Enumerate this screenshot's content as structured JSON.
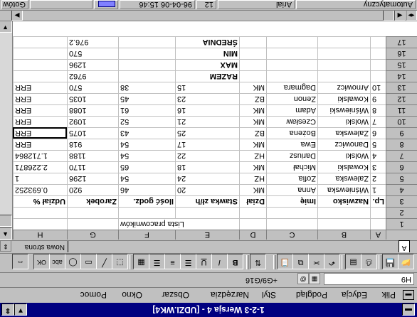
{
  "window": {
    "title": "1-2-3 Wersja 4 - [UDZI.WK4]"
  },
  "menu": {
    "items": [
      "Plik",
      "Edycja",
      "Podgląd",
      "Styl",
      "Narzędzia",
      "Obszar",
      "Okno",
      "Pomoc"
    ]
  },
  "formula_bar": {
    "cell_ref": "H9",
    "formula": "+G9/G16"
  },
  "toolbar": {
    "buttons": [
      "open-file",
      "save-file",
      "print",
      "preview",
      "undo",
      "cut",
      "copy",
      "paste",
      "sort",
      "bold",
      "italic",
      "underline",
      "align-left",
      "align-center",
      "align-right",
      "number-format",
      "select",
      "draw-line",
      "rectangle",
      "ellipse",
      "abc",
      "ok"
    ],
    "bold_label": "B",
    "italic_label": "I",
    "underline_label": "U",
    "abc_label": "abc",
    "ok_label": "OK"
  },
  "sheet": {
    "tab_label": "A",
    "new_sheet_label": "Nowa strona"
  },
  "columns": [
    "A",
    "B",
    "C",
    "D",
    "E",
    "F",
    "G",
    "H"
  ],
  "rows": [
    {
      "n": "1",
      "cells": [
        "",
        "",
        "",
        "",
        "Lista pracowników",
        "",
        "",
        ""
      ]
    },
    {
      "n": "2",
      "cells": [
        "",
        "",
        "",
        "",
        "",
        "",
        "",
        ""
      ]
    },
    {
      "n": "3",
      "cells": [
        "Lp.",
        "Nazwisko",
        "Imię",
        "Dział",
        "Stawka zł/h",
        "Ilość godz.",
        "Zarobek",
        "Udział %"
      ]
    },
    {
      "n": "4",
      "cells": [
        "1",
        "Wiśniewska",
        "Anna",
        "MK",
        "20",
        "46",
        "920",
        "0.693252"
      ]
    },
    {
      "n": "5",
      "cells": [
        "2",
        "Zalewska",
        "Zofia",
        "HZ",
        "24",
        "54",
        "1296",
        "1"
      ]
    },
    {
      "n": "6",
      "cells": [
        "3",
        "Kowalski",
        "Michał",
        "MK",
        "18",
        "65",
        "1170",
        "2.226871"
      ]
    },
    {
      "n": "7",
      "cells": [
        "4",
        "Wolski",
        "Dariusz",
        "HZ",
        "22",
        "54",
        "1188",
        "1.712864"
      ]
    },
    {
      "n": "8",
      "cells": [
        "5",
        "Danowicz",
        "Ewa",
        "MK",
        "17",
        "54",
        "918",
        "ERR"
      ]
    },
    {
      "n": "9",
      "cells": [
        "6",
        "Zalewska",
        "Bożena",
        "BZ",
        "25",
        "43",
        "1075",
        "ERR"
      ]
    },
    {
      "n": "10",
      "cells": [
        "7",
        "Wolski",
        "Czesław",
        "MK",
        "21",
        "52",
        "1092",
        "ERR"
      ]
    },
    {
      "n": "11",
      "cells": [
        "8",
        "Wiśniewski",
        "Adam",
        "MK",
        "16",
        "61",
        "1088",
        "ERR"
      ]
    },
    {
      "n": "12",
      "cells": [
        "9",
        "Kowalski",
        "Zenon",
        "BZ",
        "23",
        "45",
        "1035",
        "ERR"
      ]
    },
    {
      "n": "13",
      "cells": [
        "10",
        "Arnowicz",
        "Dagmara",
        "MK",
        "15",
        "38",
        "570",
        "ERR"
      ]
    },
    {
      "n": "14",
      "cells": [
        "",
        "",
        "",
        "",
        "RAZEM",
        "",
        "9762",
        ""
      ]
    },
    {
      "n": "15",
      "cells": [
        "",
        "",
        "",
        "",
        "MAX",
        "",
        "1296",
        ""
      ]
    },
    {
      "n": "16",
      "cells": [
        "",
        "",
        "",
        "",
        "MIN",
        "",
        "570",
        ""
      ]
    },
    {
      "n": "17",
      "cells": [
        "",
        "",
        "",
        "",
        "ŚREDNIA",
        "",
        "976.2",
        ""
      ]
    }
  ],
  "status": {
    "format": "Automatyczny",
    "font": "Arial",
    "size": "12",
    "datetime": "96-04-06 15:46",
    "ready": "Gotów"
  }
}
